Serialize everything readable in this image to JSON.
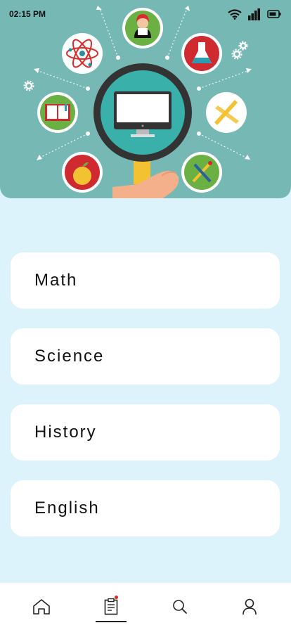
{
  "status_bar": {
    "time": "02:15 PM",
    "icons": [
      "wifi-icon",
      "signal-icon",
      "battery-icon"
    ]
  },
  "hero": {
    "illustration": "education-magnifier-illustration",
    "icons": [
      "teacher-icon",
      "atom-icon",
      "flask-icon",
      "book-icon",
      "ruler-icon",
      "apple-icon",
      "paint-brush-icon",
      "computer-icon",
      "gear-icon"
    ],
    "background_color": "#76b8b4"
  },
  "subjects": [
    {
      "label": "Math"
    },
    {
      "label": "Science"
    },
    {
      "label": "History"
    },
    {
      "label": "English"
    }
  ],
  "bottom_nav": {
    "items": [
      {
        "icon": "home-icon",
        "active": false
      },
      {
        "icon": "document-icon",
        "active": true,
        "badge": true
      },
      {
        "icon": "search-icon",
        "active": false
      },
      {
        "icon": "profile-icon",
        "active": false
      }
    ]
  },
  "colors": {
    "page_background": "#dcf3fb",
    "card_background": "#ffffff",
    "badge": "#e1261c"
  }
}
